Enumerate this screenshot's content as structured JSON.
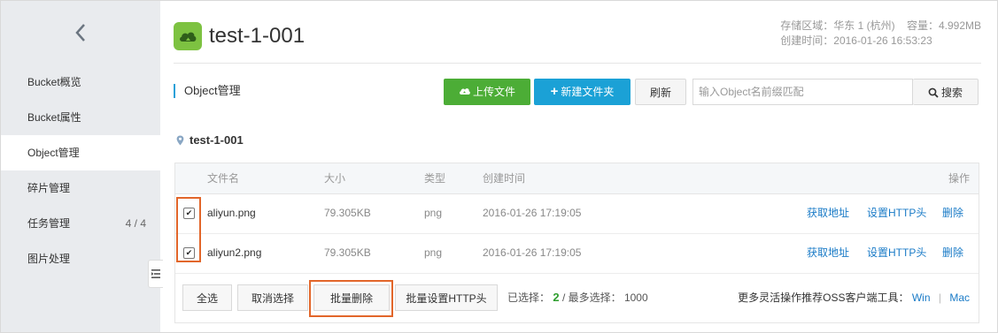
{
  "sidebar": {
    "items": [
      {
        "label": "Bucket概览"
      },
      {
        "label": "Bucket属性"
      },
      {
        "label": "Object管理"
      },
      {
        "label": "碎片管理"
      },
      {
        "label": "任务管理",
        "count": "4 / 4"
      },
      {
        "label": "图片处理"
      }
    ],
    "active_item": "Object管理"
  },
  "header": {
    "bucket_name": "test-1-001",
    "region_label": "存储区域：华东 1 (杭州)",
    "capacity_label": "容量：4.992MB",
    "created_label": "创建时间：2016-01-26 16:53:23"
  },
  "toolbar": {
    "section_title": "Object管理",
    "upload_label": "上传文件",
    "new_folder_label": "新建文件夹",
    "refresh_label": "刷新",
    "search_placeholder": "输入Object名前缀匹配",
    "search_label": "搜索"
  },
  "path": {
    "label": "test-1-001"
  },
  "table": {
    "headers": {
      "name": "文件名",
      "size": "大小",
      "type": "类型",
      "created": "创建时间",
      "actions": "操作"
    },
    "rows": [
      {
        "name": "aliyun.png",
        "size": "79.305KB",
        "type": "png",
        "created": "2016-01-26 17:19:05",
        "checked": true,
        "actions": {
          "get_url": "获取地址",
          "set_http": "设置HTTP头",
          "delete": "删除"
        }
      },
      {
        "name": "aliyun2.png",
        "size": "79.305KB",
        "type": "png",
        "created": "2016-01-26 17:19:05",
        "checked": true,
        "actions": {
          "get_url": "获取地址",
          "set_http": "设置HTTP头",
          "delete": "删除"
        }
      }
    ]
  },
  "footer": {
    "select_all": "全选",
    "deselect": "取消选择",
    "batch_delete": "批量删除",
    "batch_http": "批量设置HTTP头",
    "selected_prefix": "已选择：",
    "selected_count": "2",
    "max_label": "/ 最多选择：",
    "max_count": "1000",
    "tools_text": "更多灵活操作推荐OSS客户端工具：",
    "win_link": "Win",
    "separator": "|",
    "mac_link": "Mac"
  },
  "colors": {
    "accent_green": "#4cad36",
    "accent_blue": "#1ba1d6",
    "highlight": "#e2662a",
    "link": "#1a7bc7"
  }
}
